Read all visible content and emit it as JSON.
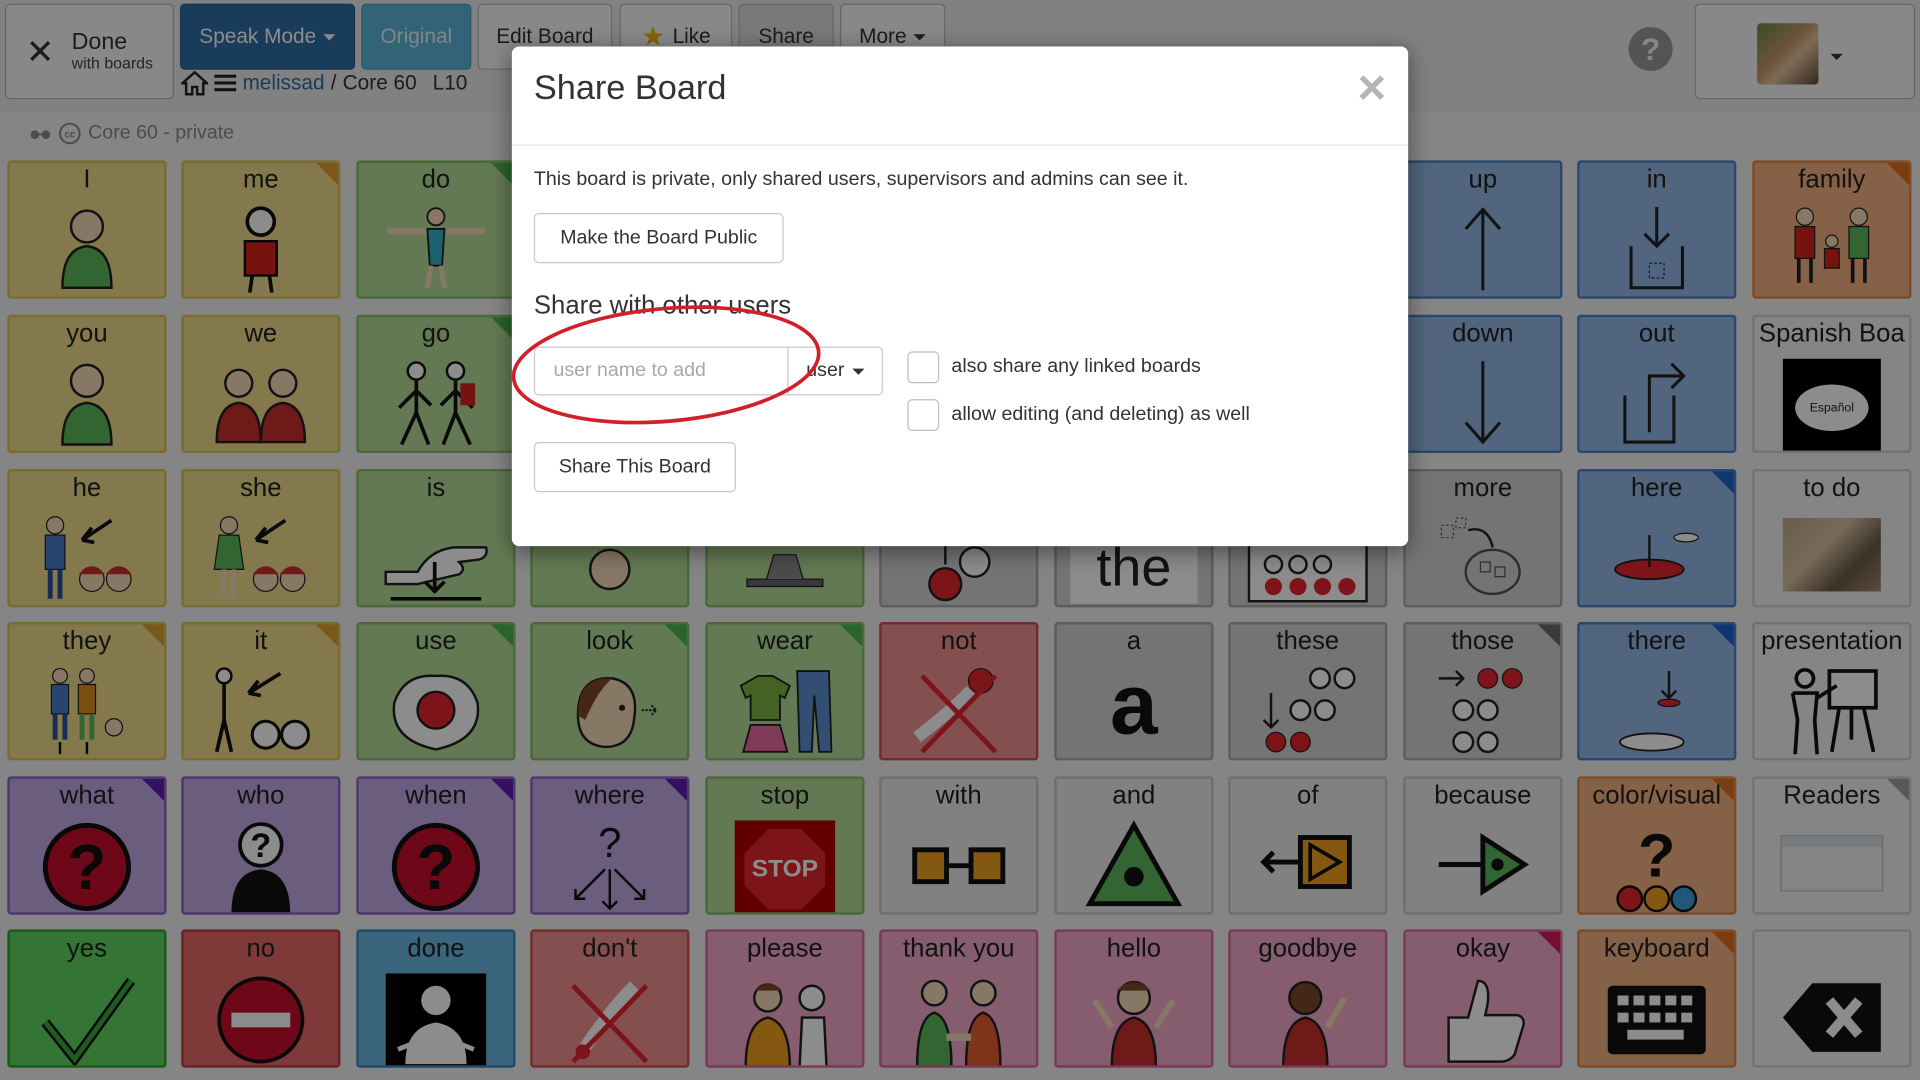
{
  "topbar": {
    "done_label": "Done",
    "done_sub": "with boards",
    "speak_mode_label": "Speak Mode",
    "original_label": "Original",
    "edit_board_label": "Edit Board",
    "like_label": "Like",
    "share_label": "Share",
    "more_label": "More",
    "breadcrumb_user": "melissad",
    "breadcrumb_sep": "/",
    "breadcrumb_board": "Core 60",
    "breadcrumb_level": "L10",
    "help_symbol": "?"
  },
  "board": {
    "name": "Core 60 - private",
    "cells": [
      {
        "label": "I"
      },
      {
        "label": "me"
      },
      {
        "label": "do"
      },
      {
        "label": "up"
      },
      {
        "label": "in"
      },
      {
        "label": "family"
      },
      {
        "label": "you"
      },
      {
        "label": "we"
      },
      {
        "label": "go"
      },
      {
        "label": "down"
      },
      {
        "label": "out"
      },
      {
        "label": "Spanish Boa"
      },
      {
        "label": "he"
      },
      {
        "label": "she"
      },
      {
        "label": "is"
      },
      {
        "label": "more"
      },
      {
        "label": "here"
      },
      {
        "label": "to do"
      },
      {
        "label": "they"
      },
      {
        "label": "it"
      },
      {
        "label": "use"
      },
      {
        "label": "look"
      },
      {
        "label": "wear"
      },
      {
        "label": "not"
      },
      {
        "label": "a"
      },
      {
        "label": "these"
      },
      {
        "label": "those"
      },
      {
        "label": "there"
      },
      {
        "label": "presentation"
      },
      {
        "label": "what"
      },
      {
        "label": "who"
      },
      {
        "label": "when"
      },
      {
        "label": "where"
      },
      {
        "label": "stop"
      },
      {
        "label": "with"
      },
      {
        "label": "and"
      },
      {
        "label": "of"
      },
      {
        "label": "because"
      },
      {
        "label": "color/visual"
      },
      {
        "label": "Readers"
      },
      {
        "label": "yes"
      },
      {
        "label": "no"
      },
      {
        "label": "done"
      },
      {
        "label": "don't"
      },
      {
        "label": "please"
      },
      {
        "label": "thank you"
      },
      {
        "label": "hello"
      },
      {
        "label": "goodbye"
      },
      {
        "label": "okay"
      },
      {
        "label": "keyboard"
      }
    ],
    "partial_text": {
      "the": "the",
      "a_symbol": "a",
      "stop_sign": "STOP",
      "espanol": "Español"
    }
  },
  "modal": {
    "title": "Share Board",
    "close_symbol": "×",
    "private_note": "This board is private, only shared users, supervisors and admins can see it.",
    "make_public_label": "Make the Board Public",
    "share_heading": "Share with other users",
    "user_input_placeholder": "user name to add",
    "user_type_label": "user",
    "also_share_linked_label": "also share any linked boards",
    "allow_editing_label": "allow editing (and deleting) as well",
    "share_this_board_label": "Share This Board"
  }
}
